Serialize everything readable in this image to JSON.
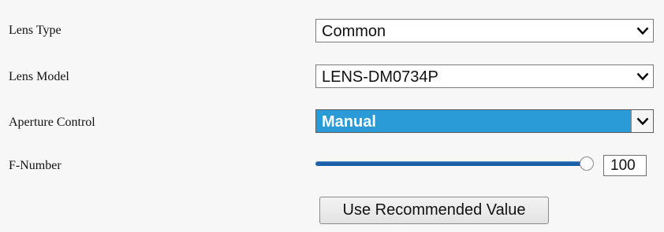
{
  "form": {
    "lens_type": {
      "label": "Lens Type",
      "value": "Common"
    },
    "lens_model": {
      "label": "Lens Model",
      "value": "LENS-DM0734P"
    },
    "aperture_control": {
      "label": "Aperture Control",
      "value": "Manual",
      "highlight_color": "#2b9bd8"
    },
    "f_number": {
      "label": "F-Number",
      "value": "100",
      "fill": 1.0,
      "fill_color": "#1a5ea8"
    },
    "recommend_button": "Use Recommended Value"
  }
}
